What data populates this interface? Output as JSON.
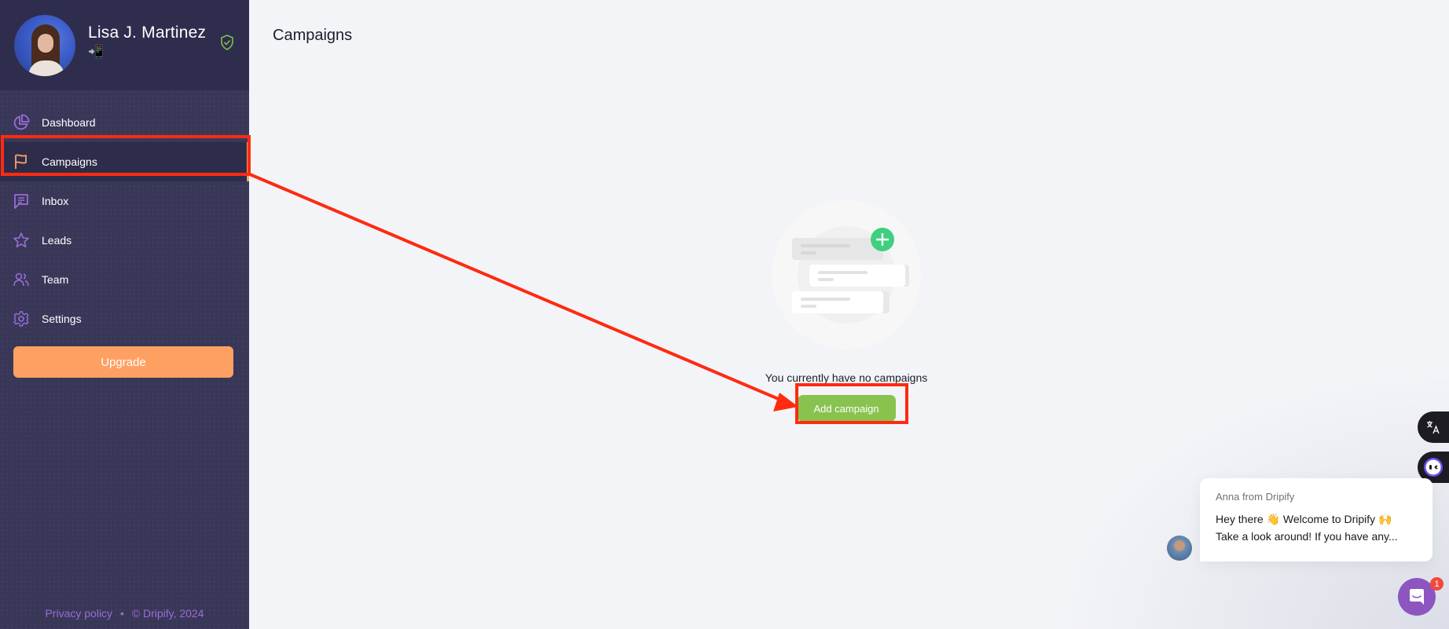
{
  "profile": {
    "name": "Lisa J. Martinez",
    "status_emoji": "📲",
    "verified_icon": "shield-check-icon"
  },
  "sidebar": {
    "items": [
      {
        "label": "Dashboard",
        "icon": "pie-chart-icon",
        "active": false
      },
      {
        "label": "Campaigns",
        "icon": "flag-icon",
        "active": true
      },
      {
        "label": "Inbox",
        "icon": "message-icon",
        "active": false
      },
      {
        "label": "Leads",
        "icon": "star-icon",
        "active": false
      },
      {
        "label": "Team",
        "icon": "users-icon",
        "active": false
      },
      {
        "label": "Settings",
        "icon": "gear-icon",
        "active": false
      }
    ],
    "upgrade_label": "Upgrade",
    "footer": {
      "privacy": "Privacy policy",
      "separator": "•",
      "copyright": "© Dripify, 2024"
    }
  },
  "main": {
    "title": "Campaigns",
    "empty_state": {
      "message": "You currently have no campaigns",
      "button_label": "Add campaign"
    }
  },
  "chat": {
    "from": "Anna from Dripify",
    "line1": "Hey there 👋 Welcome to Dripify 🙌",
    "line2": "Take a look around! If you have any...",
    "badge_count": "1"
  },
  "colors": {
    "sidebar_bg": "#393757",
    "accent_orange": "#ffa063",
    "icon_purple": "#9a6cd8",
    "add_green": "#88c34f",
    "annotation_red": "#ff2a10"
  }
}
